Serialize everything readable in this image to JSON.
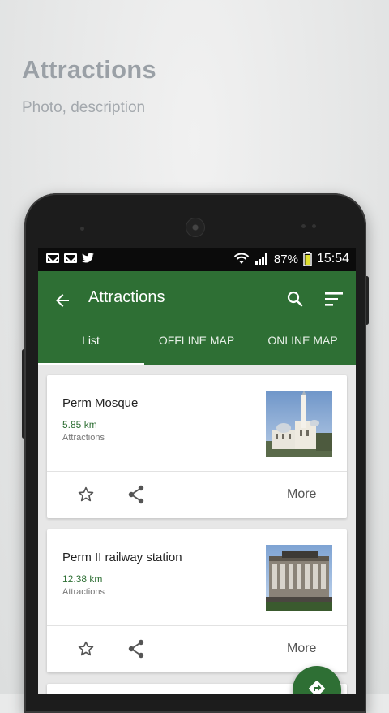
{
  "promo": {
    "title": "Attractions",
    "subtitle": "Photo, description"
  },
  "statusbar": {
    "battery_percent": "87%",
    "time": "15:54",
    "icons_left": [
      "mail-icon",
      "mail-icon",
      "twitter-icon"
    ],
    "icons_right": [
      "wifi-icon",
      "signal-icon",
      "battery-icon"
    ]
  },
  "appbar": {
    "title": "Attractions",
    "color": "#2e6f34"
  },
  "tabs": [
    {
      "label": "List",
      "selected": true
    },
    {
      "label": "OFFLINE MAP",
      "selected": false
    },
    {
      "label": "ONLINE MAP",
      "selected": false
    }
  ],
  "cards": [
    {
      "title": "Perm Mosque",
      "distance": "5.85 km",
      "category": "Attractions",
      "more_label": "More"
    },
    {
      "title": "Perm II railway station",
      "distance": "12.38 km",
      "category": "Attractions",
      "more_label": "More"
    }
  ],
  "fab": {
    "icon": "directions-icon"
  }
}
